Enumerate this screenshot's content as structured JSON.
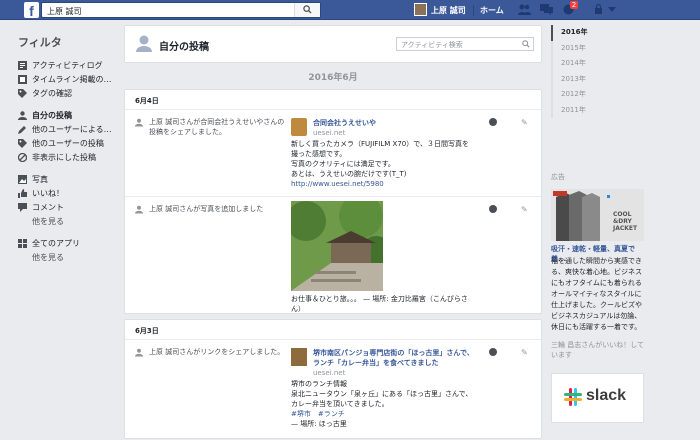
{
  "topbar": {
    "logo": "f",
    "search_value": "上原 誠司",
    "user_name": "上原 誠司",
    "home_label": "ホーム",
    "notification_count": "2",
    "colors": {
      "bar": "#3b5998",
      "badge": "#fa3e3e"
    }
  },
  "leftnav": {
    "title": "フィルタ",
    "items": [
      {
        "label": "アクティビティログ",
        "icon": "activity-log-icon"
      },
      {
        "label": "タイムライン掲載の…",
        "icon": "timeline-icon"
      },
      {
        "label": "タグの確認",
        "icon": "tag-icon"
      },
      {
        "label": "自分の投稿",
        "icon": "person-icon"
      },
      {
        "label": "他のユーザーによる…",
        "icon": "pencil-icon"
      },
      {
        "label": "他のユーザーの投稿",
        "icon": "tag-icon"
      },
      {
        "label": "非表示にした投稿",
        "icon": "hidden-icon"
      },
      {
        "label": "写真",
        "icon": "photo-icon"
      },
      {
        "label": "いいね！",
        "icon": "thumbs-up-icon"
      },
      {
        "label": "コメント",
        "icon": "comment-icon"
      },
      {
        "label": "他を見る",
        "icon": ""
      },
      {
        "label": "全てのアプリ",
        "icon": "apps-icon"
      },
      {
        "label": "他を見る",
        "icon": ""
      }
    ]
  },
  "main": {
    "header_title": "自分の投稿",
    "search_placeholder": "アクティビティ検索",
    "month_label": "2016年6月",
    "sections": [
      {
        "date": "6月4日"
      },
      {
        "date": "6月3日"
      }
    ],
    "posts": [
      {
        "actor": "上原 誠司さんが合同会社うえせいやさんの投稿をシェアしました。",
        "page_name": "合同会社うえせいや",
        "page_url": "uesei.net",
        "text1": "新しく買ったカメラ（FUJIFILM X70）で、３日間写真を",
        "text2": "撮った感想です。",
        "text3": "写真のクオリティには満足です。",
        "text4": "あとは、うえせいの腕だけです(T_T)",
        "link": "http://www.uesei.net/5980"
      },
      {
        "actor": "上原 誠司さんが写真を追加しました",
        "caption": "お仕事＆ひとり旅。。。 — 場所: 金刀比羅宮（こんぴらさ",
        "caption2": "ん）"
      },
      {
        "actor": "上原 誠司さんがリンクをシェアしました。",
        "link_title1": "堺市南区パンジョ専門店街の「ほっ古里」さんで、",
        "link_title2": "ランチ「カレー弁当」を食べてきました",
        "domain": "uesei.net",
        "text1": "堺市のランチ情報",
        "text2": "泉北ニュータウン「泉ヶ丘」にある「ほっ古里」さんで、",
        "text3": "カレー弁当を頂いてきました。",
        "tags": "#堺市　#ランチ",
        "place": "— 場所: ほっ古里"
      }
    ]
  },
  "right": {
    "years": [
      "2016年",
      "2015年",
      "2014年",
      "2013年",
      "2012年",
      "2011年"
    ],
    "selected_year": "2016年",
    "ad_label": "広告",
    "ad_image_text1": "COOL",
    "ad_image_text2": "&DRY",
    "ad_image_text3": "JACKET",
    "ad_title": "吸汗・速乾・軽量、真夏で着...",
    "ad_body": "袖を通した瞬間から実感できる、爽快な着心地。ビジネスにもオフタイムにも着られるオールマイティなスタイルに仕上げました。クールビズやビジネスカジュアルは勿論、休日にも活躍する一着です。",
    "ad_like": "三輪 昌志さんがいいね！しています",
    "ad2_word": "slack"
  }
}
